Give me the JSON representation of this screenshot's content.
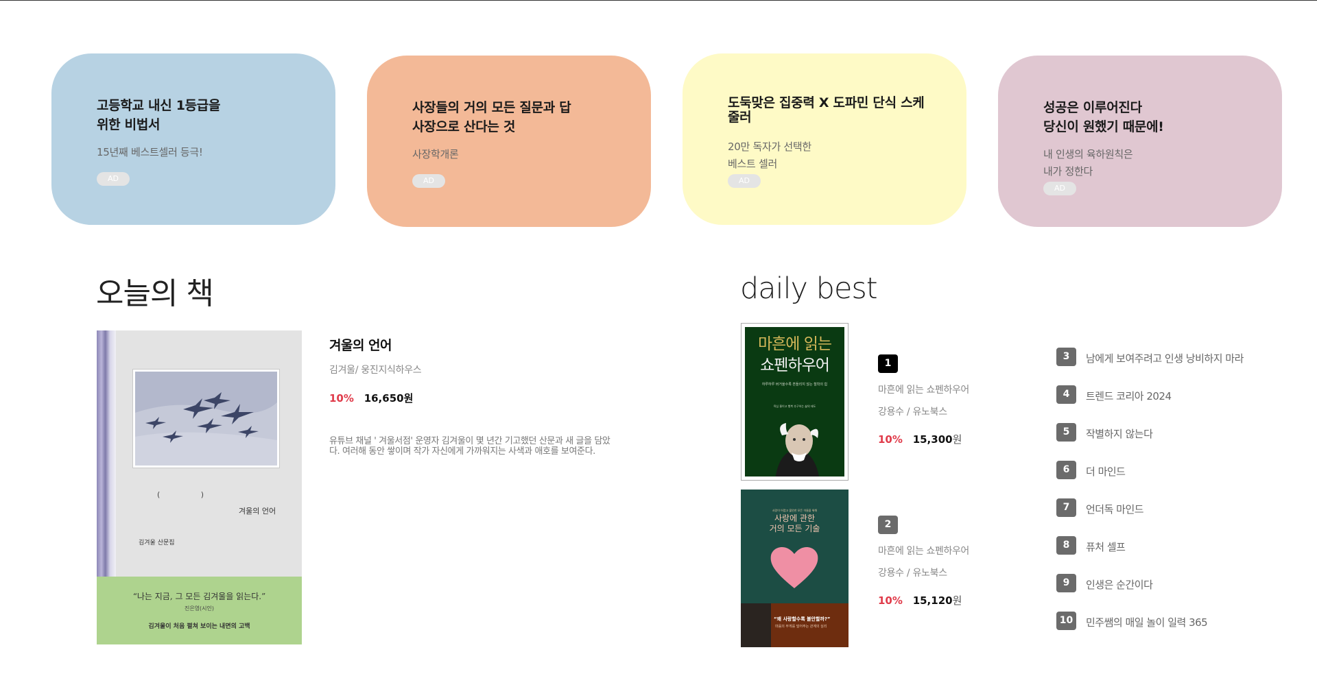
{
  "ads": [
    {
      "title": "고등학교 내신 1등급을\n위한 비법서",
      "subtitle": "15년째 베스트셀러 등극!",
      "badge": "AD",
      "color": "#b7d2e3"
    },
    {
      "title": "사장들의 거의 모든 질문과 답\n사장으로 산다는 것",
      "subtitle": "사장학개론",
      "badge": "AD",
      "color": "#f3b997"
    },
    {
      "title": "도둑맞은 집중력 X 도파민 단식 스케줄러",
      "subtitle": "20만 독자가 선택한\n베스트 셀러",
      "badge": "AD",
      "color": "#fefac6"
    },
    {
      "title": "성공은 이루어진다\n당신이 원했기 때문에!",
      "subtitle": "내 인생의 육하원칙은\n내가 정한다",
      "badge": "AD",
      "color": "#e0c7d1"
    }
  ],
  "today": {
    "section_title": "오늘의 책",
    "title": "겨울의 언어",
    "meta": "김겨울/ 웅진지식하우스",
    "discount": "10%",
    "price": "16,650원",
    "description": "유튜브 채널 ' 겨울서점' 운영자 김겨울이 몇 년간 기고했던 산문과 새 글을 담았다. 여러해 동안 쌓이며 작가 자신에게 가까워지는 사색과 애호를 보여준다.",
    "cover": {
      "brackets": "( )",
      "title": "겨울의 언어",
      "author": "김겨울 산문집",
      "quote": "“나는 지금, 그 모든 김겨울을 읽는다.”",
      "quote_by": "진은영(시인)",
      "tagline": "김겨울이 처음 펼쳐 보이는 내면의 고백"
    }
  },
  "daily_best": {
    "section_title": "daily best",
    "top": [
      {
        "rank": "1",
        "name": "마흔에 읽는 쇼펜하우어",
        "meta": "강용수 / 유노북스",
        "discount": "10%",
        "price": "15,300",
        "won": "원",
        "cover": {
          "line1": "마흔에 읽는",
          "line2": "쇼펜하우어",
          "sub": "하루하루 버거울수록 흔들리지 않는 철학의 힘",
          "sub2": "욕심 줄이고 행복 추구하는 삶의 태도"
        }
      },
      {
        "rank": "2",
        "name": "마흔에 읽는 쇼펜하우어",
        "meta": "강용수 / 유노북스",
        "discount": "10%",
        "price": "15,120",
        "won": "원",
        "cover": {
          "small": "사랑이 어렵고 불안한 모든 이들을 위해",
          "line1": "사랑에 관한",
          "line2": "거의 모든 기술",
          "quote": "“왜 사랑할수록 불안할까?”",
          "quote2": "마음의 무게를 덜어주는 관계의 심리"
        }
      }
    ],
    "list": [
      {
        "rank": "3",
        "title": "남에게 보여주려고 인생 낭비하지 마라"
      },
      {
        "rank": "4",
        "title": "트렌드 코리아 2024"
      },
      {
        "rank": "5",
        "title": "작별하지 않는다"
      },
      {
        "rank": "6",
        "title": "더 마인드"
      },
      {
        "rank": "7",
        "title": "언더독 마인드"
      },
      {
        "rank": "8",
        "title": "퓨처 셀프"
      },
      {
        "rank": "9",
        "title": "인생은 순간이다"
      },
      {
        "rank": "10",
        "title": "민주쌤의 매일 놀이 일력 365"
      }
    ]
  }
}
